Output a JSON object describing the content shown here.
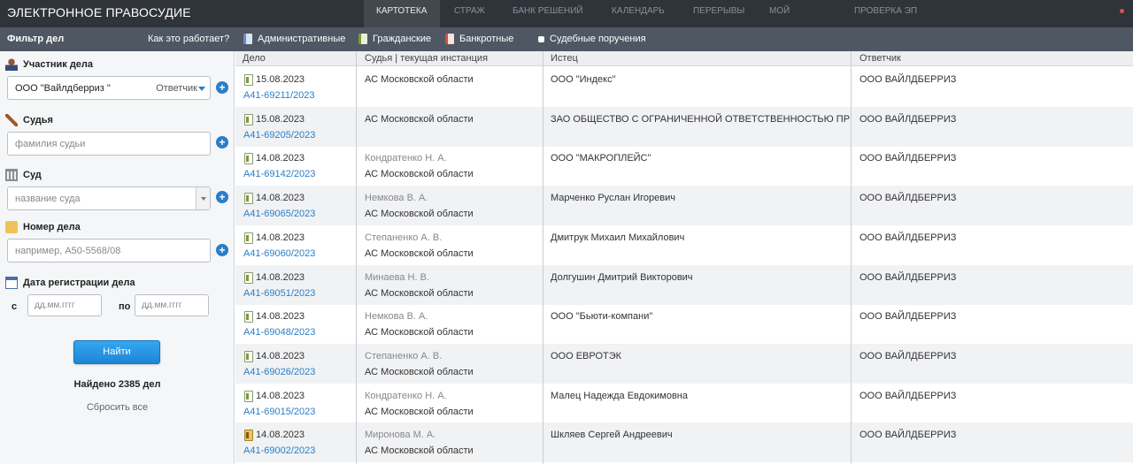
{
  "header": {
    "brand": "ЭЛЕКТРОННОЕ ПРАВОСУДИЕ",
    "nav": [
      {
        "label": "КАРТОТЕКА",
        "active": true
      },
      {
        "label": "СТРАЖ",
        "active": false
      },
      {
        "label": "БАНК РЕШЕНИЙ",
        "active": false
      },
      {
        "label": "КАЛЕНДАРЬ",
        "active": false
      },
      {
        "label": "ПЕРЕРЫВЫ",
        "active": false
      },
      {
        "label": "МОЙ АРБИТР",
        "active": false
      },
      {
        "label": "ПРОВЕРКА ЭП",
        "active": false
      }
    ]
  },
  "filterbar": {
    "title": "Фильтр дел",
    "how_it_works": "Как это работает?",
    "tabs": [
      {
        "label": "Административные",
        "icon": "administrative-icon"
      },
      {
        "label": "Гражданские",
        "icon": "civil-icon"
      },
      {
        "label": "Банкротные",
        "icon": "bankruptcy-icon"
      },
      {
        "label": "Судебные поручения",
        "icon": "checkbox-icon"
      }
    ]
  },
  "sidebar": {
    "participant_label": "Участник дела",
    "participant_value": "ООО \"Вайлдберриз \"",
    "participant_role": "Ответчик",
    "judge_label": "Судья",
    "judge_placeholder": "фамилия судьи",
    "court_label": "Суд",
    "court_placeholder": "название суда",
    "case_label": "Номер дела",
    "case_placeholder": "например, А50-5568/08",
    "date_label": "Дата регистрации дела",
    "from_label": "с",
    "to_label": "по",
    "date_placeholder": "дд.мм.гггг",
    "find_button": "Найти",
    "found_text": "Найдено 2385 дел",
    "reset_text": "Сбросить все"
  },
  "table": {
    "columns": [
      "Дело",
      "Судья | текущая инстанция",
      "Истец",
      "Ответчик"
    ],
    "rows": [
      {
        "date": "15.08.2023",
        "case": "А41-69211/2023",
        "judge": "",
        "court": "АС Московской области",
        "plaintiff": "ООО \"Индекс\"",
        "defendant": "ООО ВАЙЛДБЕРРИЗ",
        "icon": "document-icon"
      },
      {
        "date": "15.08.2023",
        "case": "А41-69205/2023",
        "judge": "",
        "court": "АС Московской области",
        "plaintiff": "ЗАО ОБЩЕСТВО С ОГРАНИЧЕННОЙ ОТВЕТСТВЕННОСТЬЮ ПР",
        "defendant": "ООО ВАЙЛДБЕРРИЗ",
        "icon": "document-icon"
      },
      {
        "date": "14.08.2023",
        "case": "А41-69142/2023",
        "judge": "Кондратенко Н. А.",
        "court": "АС Московской области",
        "plaintiff": "ООО \"МАКРОПЛЕЙС\"",
        "defendant": "ООО ВАЙЛДБЕРРИЗ",
        "icon": "document-icon"
      },
      {
        "date": "14.08.2023",
        "case": "А41-69065/2023",
        "judge": "Немкова В. А.",
        "court": "АС Московской области",
        "plaintiff": "Марченко Руслан Игоревич",
        "defendant": "ООО ВАЙЛДБЕРРИЗ",
        "icon": "document-icon"
      },
      {
        "date": "14.08.2023",
        "case": "А41-69060/2023",
        "judge": "Степаненко А. В.",
        "court": "АС Московской области",
        "plaintiff": "Дмитрук Михаил Михайлович",
        "defendant": "ООО ВАЙЛДБЕРРИЗ",
        "icon": "document-icon"
      },
      {
        "date": "14.08.2023",
        "case": "А41-69051/2023",
        "judge": "Минаева Н. В.",
        "court": "АС Московской области",
        "plaintiff": "Долгушин Дмитрий Викторович",
        "defendant": "ООО ВАЙЛДБЕРРИЗ",
        "icon": "document-icon"
      },
      {
        "date": "14.08.2023",
        "case": "А41-69048/2023",
        "judge": "Немкова В. А.",
        "court": "АС Московской области",
        "plaintiff": "ООО \"Бьюти-компани\"",
        "defendant": "ООО ВАЙЛДБЕРРИЗ",
        "icon": "document-icon"
      },
      {
        "date": "14.08.2023",
        "case": "А41-69026/2023",
        "judge": "Степаненко А. В.",
        "court": "АС Московской области",
        "plaintiff": "ООО ЕВРОТЭК",
        "defendant": "ООО ВАЙЛДБЕРРИЗ",
        "icon": "document-icon"
      },
      {
        "date": "14.08.2023",
        "case": "А41-69015/2023",
        "judge": "Кондратенко Н. А.",
        "court": "АС Московской области",
        "plaintiff": "Малец Надежда Евдокимовна",
        "defendant": "ООО ВАЙЛДБЕРРИЗ",
        "icon": "document-icon"
      },
      {
        "date": "14.08.2023",
        "case": "А41-69002/2023",
        "judge": "Миронова М. А.",
        "court": "АС Московской области",
        "plaintiff": "Шкляев Сергей Андреевич",
        "defendant": "ООО ВАЙЛДБЕРРИЗ",
        "icon": "document-gold-icon"
      }
    ]
  },
  "colors": {
    "topbar": "#2f333a",
    "filterbar": "#4e5762",
    "link": "#2a7ec7",
    "button": "#1e86d4"
  }
}
